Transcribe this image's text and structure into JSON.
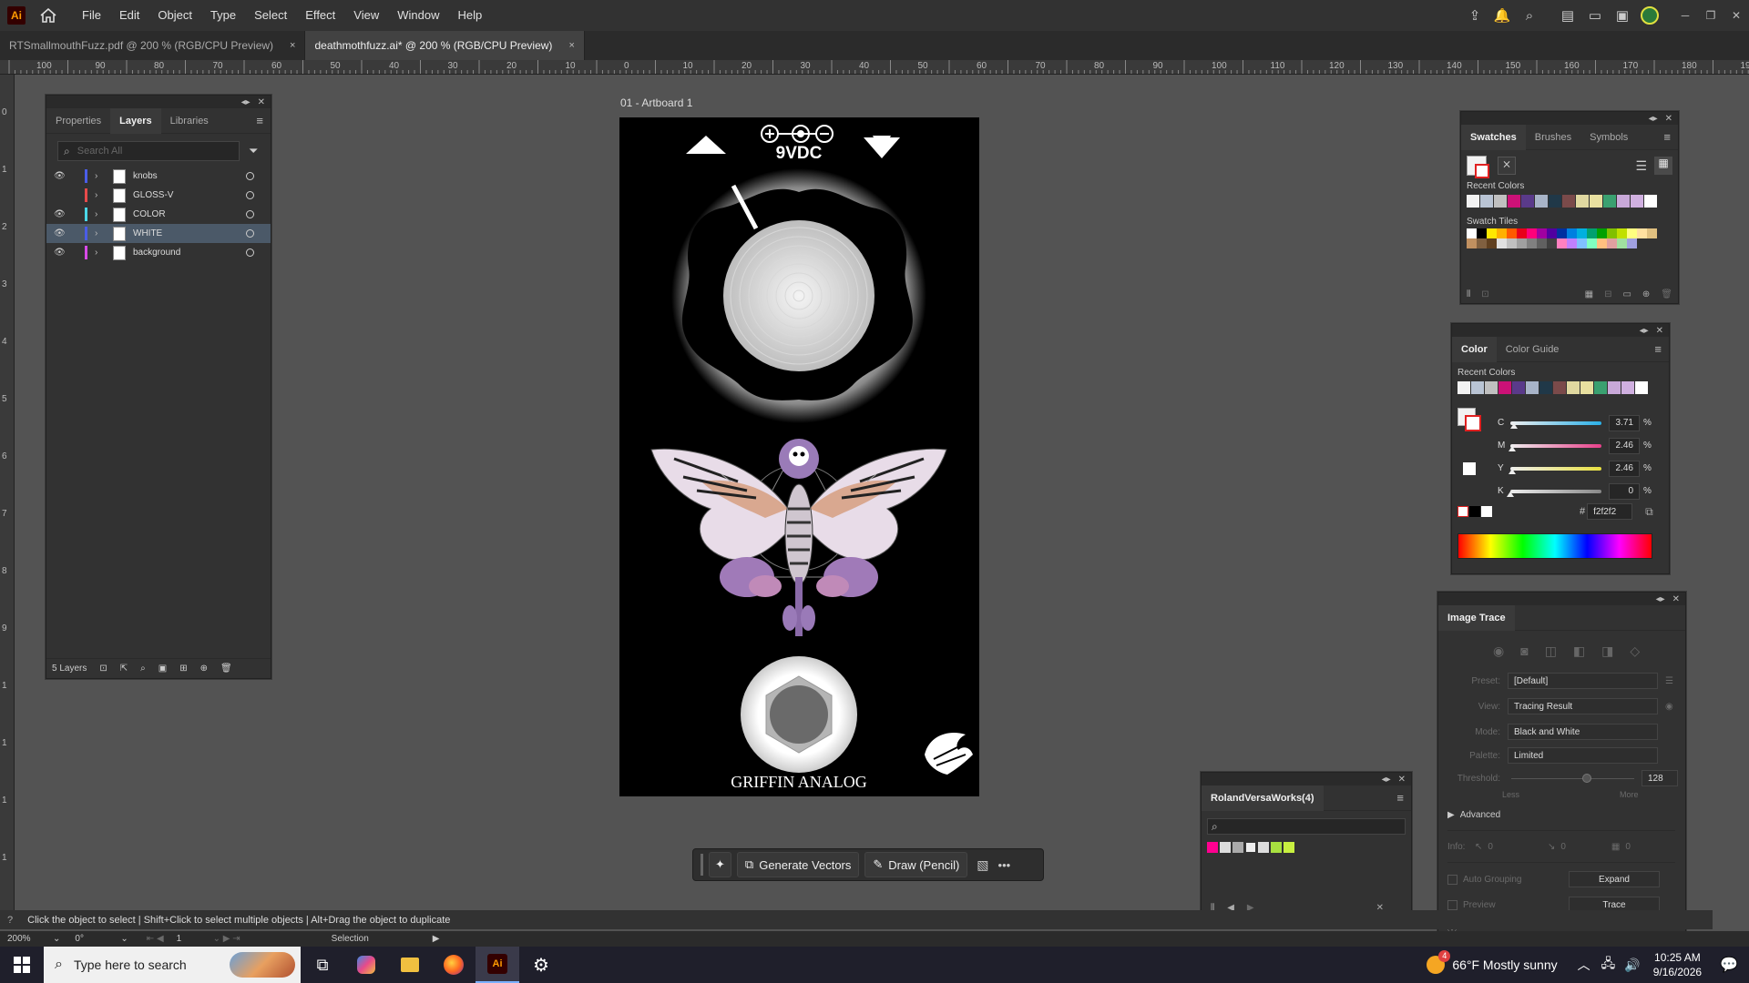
{
  "app": {
    "logo": "Ai"
  },
  "menu": [
    "File",
    "Edit",
    "Object",
    "Type",
    "Select",
    "Effect",
    "View",
    "Window",
    "Help"
  ],
  "tabs": [
    {
      "label": "RTSmallmouthFuzz.pdf @ 200 % (RGB/CPU Preview)",
      "close": "×"
    },
    {
      "label": "deathmothfuzz.ai* @ 200 % (RGB/CPU Preview)",
      "close": "×"
    }
  ],
  "ruler_top": [
    "100",
    "90",
    "80",
    "70",
    "60",
    "50",
    "40",
    "30",
    "20",
    "10",
    "0",
    "10",
    "20",
    "30",
    "40",
    "50",
    "60",
    "70",
    "80",
    "90",
    "100",
    "110",
    "120",
    "130",
    "140",
    "150",
    "160",
    "170",
    "180",
    "190"
  ],
  "ruler_left": [
    "0",
    "1",
    "2",
    "3",
    "4",
    "5",
    "6",
    "7",
    "8",
    "9",
    "1",
    "1",
    "1",
    "1",
    "1",
    "1"
  ],
  "layers_panel": {
    "tabs": [
      "Properties",
      "Layers",
      "Libraries"
    ],
    "search_placeholder": "Search All",
    "layers": [
      {
        "name": "knobs",
        "color": "#4a5de8",
        "visible": true
      },
      {
        "name": "GLOSS-V",
        "color": "#e84a4a",
        "visible": false
      },
      {
        "name": "COLOR",
        "color": "#4ad8e8",
        "visible": true
      },
      {
        "name": "WHITE",
        "color": "#4a5de8",
        "visible": true,
        "selected": true
      },
      {
        "name": "background",
        "color": "#d84ae8",
        "visible": true
      }
    ],
    "footer_count": "5 Layers"
  },
  "artboard": {
    "name": "01 - Artboard 1",
    "power_label": "9VDC",
    "brand": "GRIFFIN ANALOG"
  },
  "context_bar": {
    "generate": "Generate Vectors",
    "draw": "Draw (Pencil)",
    "more": "•••"
  },
  "swatches_panel": {
    "tabs": [
      "Swatches",
      "Brushes",
      "Symbols"
    ],
    "recent_label": "Recent Colors",
    "tiles_label": "Swatch Tiles",
    "recent": [
      "#f2f2f2",
      "#b9c4d4",
      "#c0c0c0",
      "#cc1177",
      "#5a3a8a",
      "#a8b4c8",
      "#203848",
      "#7a4a4a",
      "#e0d8a0",
      "#e8e0a0",
      "#3aa070",
      "#c8a8d8",
      "#d0b0e0",
      "#ffffff"
    ],
    "tiles": [
      "#ffffff",
      "#000000",
      "#ffe800",
      "#ffb000",
      "#ff5a00",
      "#e8001a",
      "#ff007a",
      "#a000a0",
      "#5000a0",
      "#0030a0",
      "#0080e0",
      "#00b0e0",
      "#00a070",
      "#00a000",
      "#80c000",
      "#c0e000",
      "#ffff80",
      "#ffe0a0",
      "#e0c080",
      "#c09060",
      "#806040",
      "#604020",
      "#e0e0e0",
      "#c0c0c0",
      "#a0a0a0",
      "#808080",
      "#606060",
      "#404040",
      "#ff80c0",
      "#c080ff",
      "#80c0ff",
      "#80ffc0",
      "#ffc080",
      "#e0a0a0",
      "#a0e0a0",
      "#a0a0e0"
    ]
  },
  "color_panel": {
    "tabs": [
      "Color",
      "Color Guide"
    ],
    "recent_label": "Recent Colors",
    "recent": [
      "#f2f2f2",
      "#b9c4d4",
      "#c0c0c0",
      "#cc1177",
      "#5a3a8a",
      "#a8b4c8",
      "#203848",
      "#7a4a4a",
      "#e0d8a0",
      "#e8e0a0",
      "#3aa070",
      "#c8a8d8",
      "#d0b0e0",
      "#ffffff"
    ],
    "channels": [
      {
        "label": "C",
        "value": "3.71",
        "pct": "%",
        "color": "#2ab0e8",
        "level": 0.0371
      },
      {
        "label": "M",
        "value": "2.46",
        "pct": "%",
        "color": "#e8408a",
        "level": 0.0246
      },
      {
        "label": "Y",
        "value": "2.46",
        "pct": "%",
        "color": "#e8e040",
        "level": 0.0246
      },
      {
        "label": "K",
        "value": "0",
        "pct": "%",
        "color": "#888888",
        "level": 0
      }
    ],
    "hex_label": "#",
    "hex": "f2f2f2"
  },
  "image_trace": {
    "title": "Image Trace",
    "preset_label": "Preset:",
    "preset": "[Default]",
    "view_label": "View:",
    "view": "Tracing Result",
    "mode_label": "Mode:",
    "mode": "Black and White",
    "palette_label": "Palette:",
    "palette": "Limited",
    "threshold_label": "Threshold:",
    "threshold": "128",
    "less": "Less",
    "more": "More",
    "advanced": "Advanced",
    "info_label": "Info:",
    "info_a": "0",
    "info_b": "0",
    "info_c": "0",
    "auto_grouping": "Auto Grouping",
    "expand": "Expand",
    "preview": "Preview",
    "trace": "Trace"
  },
  "roland_panel": {
    "title": "RolandVersaWorks(4)"
  },
  "status": {
    "hint": "Click the object to select  |  Shift+Click to select multiple objects  |  Alt+Drag the object to duplicate",
    "zoom": "200%",
    "angle": "0°",
    "artboard_num": "1",
    "tool": "Selection"
  },
  "taskbar": {
    "search_placeholder": "Type here to search",
    "weather": "66°F  Mostly sunny",
    "time": "10:25 AM",
    "date": "9/16/2026",
    "weather_badge": "4"
  }
}
